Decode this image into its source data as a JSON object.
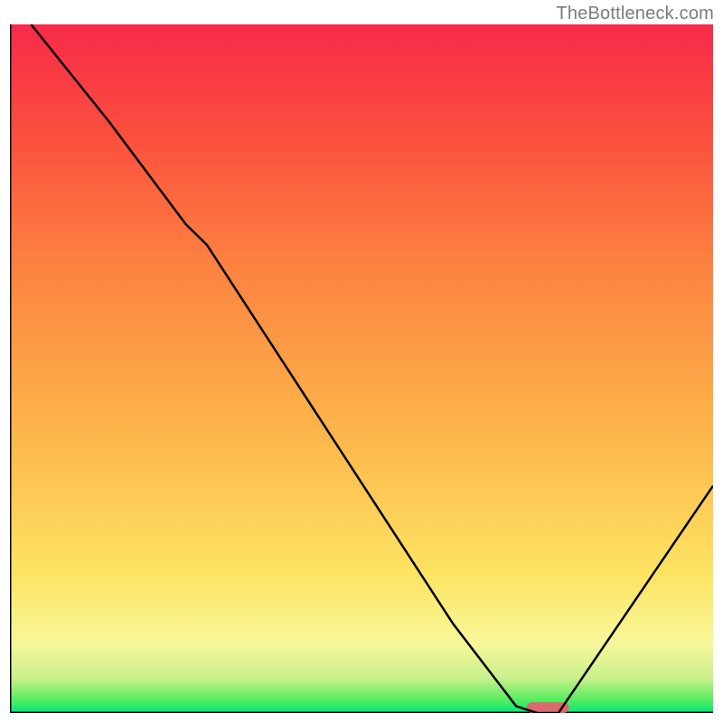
{
  "watermark": "TheBottleneck.com",
  "chart_data": {
    "type": "line",
    "title": "",
    "xlabel": "",
    "ylabel": "",
    "xlim": [
      0,
      100
    ],
    "ylim": [
      0,
      100
    ],
    "x": [
      3,
      14,
      25,
      28,
      63,
      72,
      75,
      78,
      100
    ],
    "y": [
      100,
      86,
      71,
      68,
      13,
      1,
      0,
      0,
      33
    ],
    "annotations": [],
    "background_gradient": {
      "stops": [
        {
          "pos": 0.0,
          "color": "#00e97a"
        },
        {
          "pos": 0.02,
          "color": "#5aec5f"
        },
        {
          "pos": 0.05,
          "color": "#c8f08c"
        },
        {
          "pos": 0.1,
          "color": "#f7f79a"
        },
        {
          "pos": 0.2,
          "color": "#fde463"
        },
        {
          "pos": 0.4,
          "color": "#fdb74b"
        },
        {
          "pos": 0.65,
          "color": "#fc8240"
        },
        {
          "pos": 0.85,
          "color": "#fb4c3e"
        },
        {
          "pos": 1.0,
          "color": "#f82a4a"
        }
      ]
    },
    "marker": {
      "x_center": 76.5,
      "y": 0,
      "width": 6,
      "color": "#d96a6c"
    },
    "axis_color": "#000000",
    "line_color": "#000000"
  }
}
